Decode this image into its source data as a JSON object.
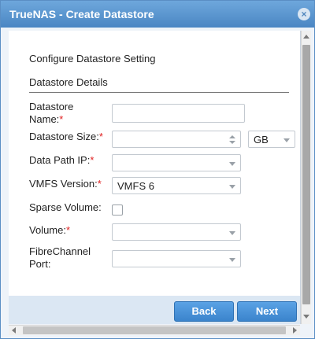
{
  "window": {
    "title": "TrueNAS - Create Datastore",
    "close_icon": "×"
  },
  "section": {
    "heading": "Configure Datastore Setting",
    "subheading": "Datastore Details"
  },
  "form": {
    "name": {
      "label": "Datastore Name:",
      "required": "*",
      "value": ""
    },
    "size": {
      "label": "Datastore Size:",
      "required": "*",
      "value": "",
      "unit": "GB"
    },
    "data_path_ip": {
      "label": "Data Path IP:",
      "required": "*",
      "value": ""
    },
    "vmfs_version": {
      "label": "VMFS Version:",
      "required": "*",
      "value": "VMFS 6"
    },
    "sparse_volume": {
      "label": "Sparse Volume:",
      "checked": false
    },
    "volume": {
      "label": "Volume:",
      "required": "*",
      "value": ""
    },
    "fc_port": {
      "label": "FibreChannel Port:",
      "value": ""
    }
  },
  "buttons": {
    "back": "Back",
    "next": "Next"
  },
  "colors": {
    "accent": "#4a86c3",
    "required": "#e02020",
    "footer": "#dbe7f3"
  }
}
